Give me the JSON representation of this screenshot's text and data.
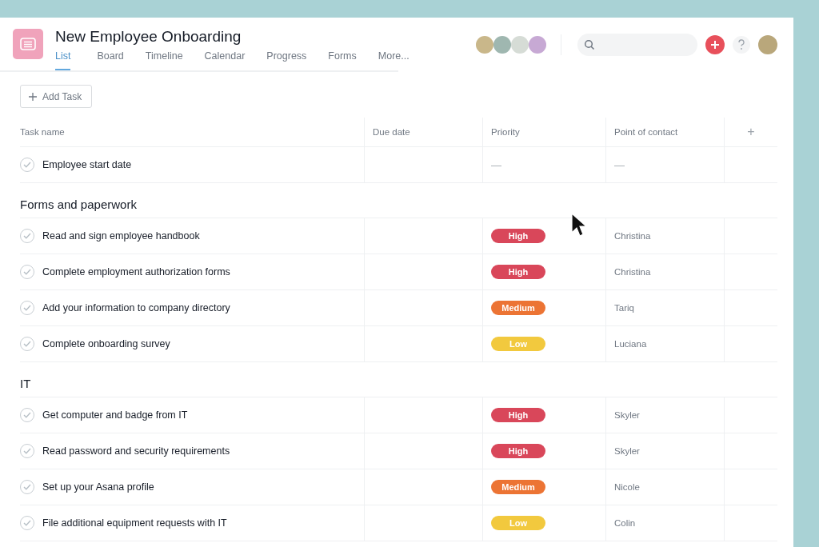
{
  "project": {
    "title": "New Employee Onboarding"
  },
  "tabs": [
    {
      "label": "List",
      "selected": true
    },
    {
      "label": "Board",
      "selected": false
    },
    {
      "label": "Timeline",
      "selected": false
    },
    {
      "label": "Calendar",
      "selected": false
    },
    {
      "label": "Progress",
      "selected": false
    },
    {
      "label": "Forms",
      "selected": false
    },
    {
      "label": "More...",
      "selected": false
    }
  ],
  "members": [
    {
      "color": "#c9b78a"
    },
    {
      "color": "#9fb7b0"
    },
    {
      "color": "#d6dcd6"
    },
    {
      "color": "#c7a9d4"
    }
  ],
  "add_task": {
    "label": "Add Task"
  },
  "table": {
    "columns": [
      "Task name",
      "Due date",
      "Priority",
      "Point of contact"
    ],
    "add_column": "+",
    "sections": [
      {
        "rows": [
          {
            "name": "Employee start date",
            "priority": "—",
            "contact": "—"
          }
        ]
      },
      {
        "title": "Forms and paperwork",
        "rows": [
          {
            "name": "Read and sign employee handbook",
            "priority": "High",
            "color": "#d9475a",
            "contact": "Christina"
          },
          {
            "name": "Complete employment authorization forms",
            "priority": "High",
            "color": "#d9475a",
            "contact": "Christina"
          },
          {
            "name": "Add your information to company directory",
            "priority": "Medium",
            "color": "#ec7434",
            "contact": "Tariq"
          },
          {
            "name": "Complete onboarding survey",
            "priority": "Low",
            "color": "#f2c93e",
            "contact": "Luciana"
          }
        ]
      },
      {
        "title": "IT",
        "rows": [
          {
            "name": "Get computer and badge from IT",
            "priority": "High",
            "color": "#d9475a",
            "contact": "Skyler"
          },
          {
            "name": "Read password and security requirements",
            "priority": "High",
            "color": "#d9475a",
            "contact": "Skyler"
          },
          {
            "name": "Set up your Asana profile",
            "priority": "Medium",
            "color": "#ec7434",
            "contact": "Nicole"
          },
          {
            "name": "File additional equipment requests with IT",
            "priority": "Low",
            "color": "#f2c93e",
            "contact": "Colin"
          }
        ]
      }
    ]
  }
}
